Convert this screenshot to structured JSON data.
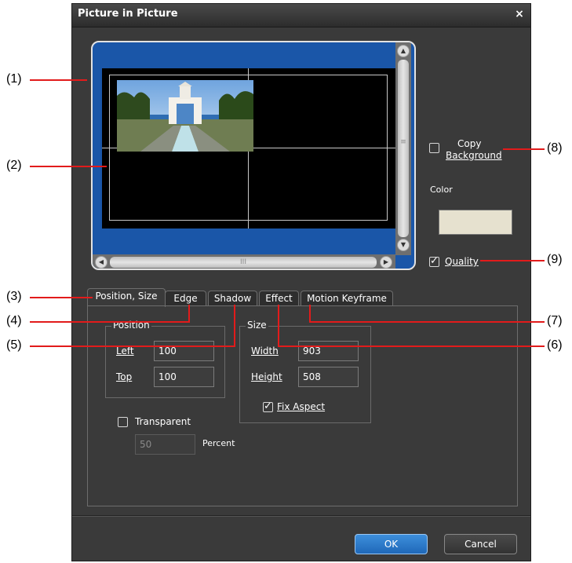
{
  "dialog": {
    "title": "Picture in Picture",
    "close_glyph": "×"
  },
  "preview": {
    "scroll_up": "▲",
    "scroll_down": "▼",
    "scroll_left": "◀",
    "scroll_right": "▶",
    "frame_color": "#1a56a8",
    "vscroll_grip": "≡",
    "hscroll_grip": "III"
  },
  "options": {
    "copy_background": {
      "label_line1": "Copy",
      "label_line2": "Background",
      "checked": false
    },
    "color_label": "Color",
    "color_value": "#e6e1cf",
    "quality": {
      "label": "Quality",
      "checked": true
    }
  },
  "tabs": [
    {
      "label": "Position, Size",
      "active": true
    },
    {
      "label": "Edge",
      "active": false
    },
    {
      "label": "Shadow",
      "active": false
    },
    {
      "label": "Effect",
      "active": false
    },
    {
      "label": "Motion Keyframe",
      "active": false
    }
  ],
  "position": {
    "group_label": "Position",
    "left_label": "Left",
    "left_value": "100",
    "top_label": "Top",
    "top_value": "100"
  },
  "size": {
    "group_label": "Size",
    "width_label": "Width",
    "width_value": "903",
    "height_label": "Height",
    "height_value": "508",
    "fix_aspect": {
      "label": "Fix Aspect",
      "checked": true
    }
  },
  "transparent": {
    "label": "Transparent",
    "checked": false,
    "value": "50",
    "unit": "Percent"
  },
  "buttons": {
    "ok": "OK",
    "cancel": "Cancel"
  },
  "callouts": [
    "(1)",
    "(2)",
    "(3)",
    "(4)",
    "(5)",
    "(6)",
    "(7)",
    "(8)",
    "(9)"
  ],
  "accent_color": "#e21b1b"
}
